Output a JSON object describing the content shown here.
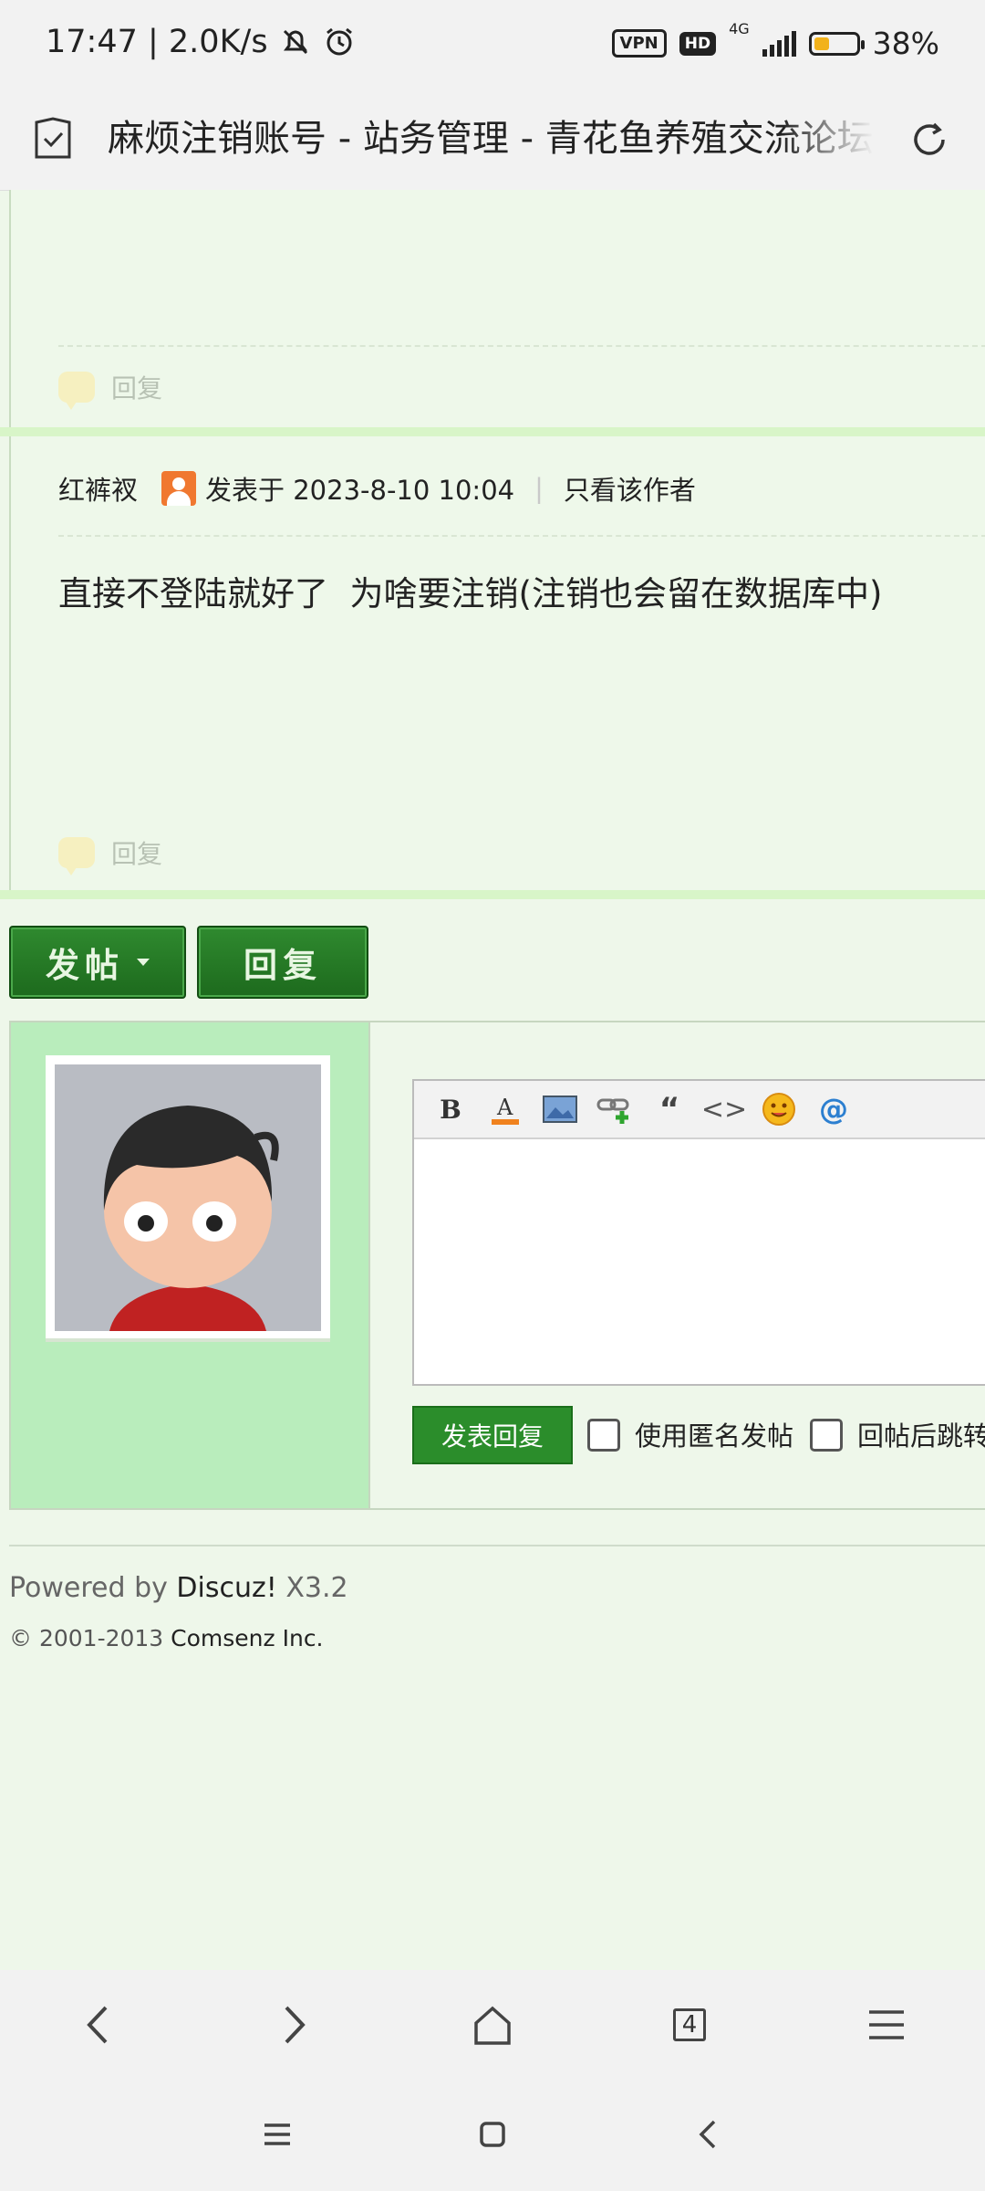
{
  "status_bar": {
    "time_speed": "17:47 | 2.0K/s",
    "vpn": "VPN",
    "hd": "HD",
    "net": "4G",
    "battery": "38%",
    "battery_level": 0.38
  },
  "browser": {
    "page_title": "麻烦注销账号 - 站务管理 - 青花鱼养殖交流论坛",
    "tab_count": "4"
  },
  "posts": [
    {
      "reply_label": "回复"
    },
    {
      "author": "红裤衩",
      "posted_at": "发表于 2023-8-10 10:04",
      "only_author": "只看该作者",
      "content": "直接不登陆就好了  为啥要注销(注销也会留在数据库中)",
      "reply_label": "回复"
    }
  ],
  "actions": {
    "new_post": "发帖",
    "reply": "回复"
  },
  "reply_form": {
    "toolbar": [
      "bold-icon",
      "font-color-icon",
      "image-icon",
      "link-icon",
      "quote-icon",
      "code-icon",
      "smiley-icon",
      "at-icon"
    ],
    "submit": "发表回复",
    "anonymous": "使用匿名发帖",
    "jump_after": "回帖后跳转到最后一页"
  },
  "footer": {
    "powered_prefix": "Powered by ",
    "powered_brand": "Discuz!",
    "powered_version": " X3.2",
    "copyright_prefix": "© 2001-2013 ",
    "copyright_company": "Comsenz Inc."
  },
  "colors": {
    "page_bg": "#eef7ea",
    "button_green": "#2b8d2b",
    "avatar_col": "#b9edbc"
  }
}
